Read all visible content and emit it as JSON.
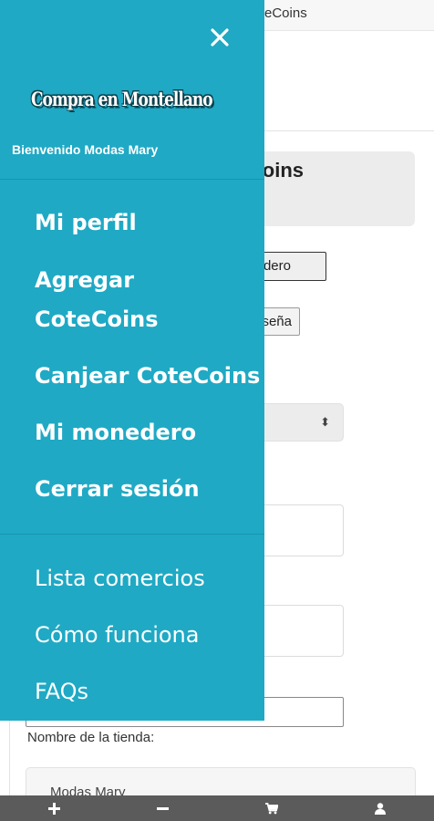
{
  "background": {
    "topbar_title": "eCoins",
    "card_title": "oins",
    "wallet_button": "dero",
    "password_button": "seña",
    "store_label": "Nombre de la tienda:",
    "store_value": "Modas Mary"
  },
  "drawer": {
    "logo_text": "Compra en Montellano",
    "welcome": "Bienvenido Modas Mary",
    "primary_items": [
      {
        "label": "Mi perfil"
      },
      {
        "label": "Agregar CoteCoins"
      },
      {
        "label": "Canjear CoteCoins"
      },
      {
        "label": "Mi monedero"
      },
      {
        "label": "Cerrar sesión"
      }
    ],
    "secondary_items": [
      {
        "label": "Lista comercios"
      },
      {
        "label": "Cómo funciona"
      },
      {
        "label": "FAQs"
      }
    ]
  },
  "bottom_bar": {
    "icons": [
      "plus-icon",
      "minus-icon",
      "cart-icon",
      "user-icon"
    ]
  },
  "colors": {
    "drawer_bg": "#1fa9c4",
    "bottom_bar_bg": "#5b5b5b"
  }
}
